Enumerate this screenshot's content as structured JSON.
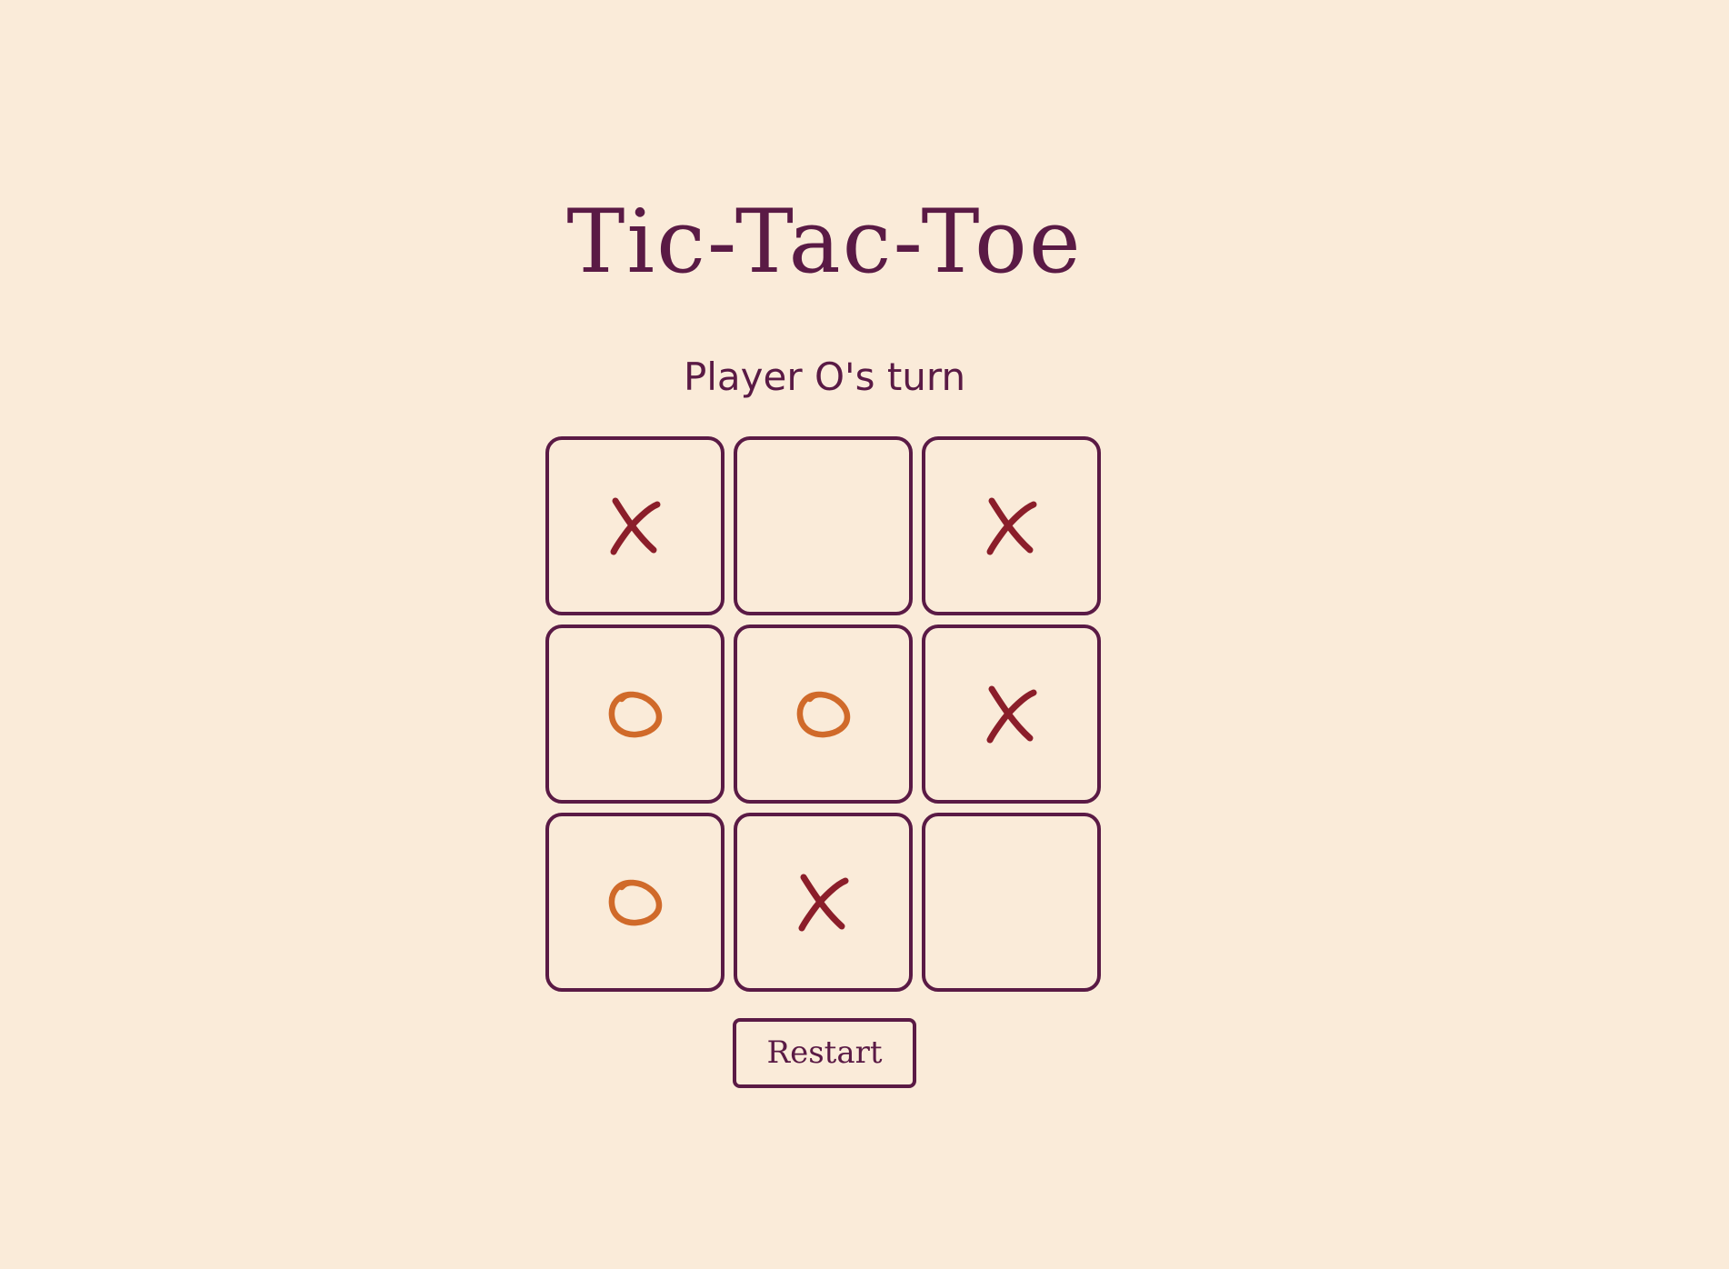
{
  "title": "Tic-Tac-Toe",
  "status": "Player O's turn",
  "board": {
    "cells": [
      "X",
      "",
      "X",
      "O",
      "O",
      "X",
      "O",
      "X",
      ""
    ]
  },
  "controls": {
    "restart_label": "Restart"
  },
  "colors": {
    "background": "#faebd9",
    "ink": "#5a1a45",
    "x_mark": "#8b1e2a",
    "o_mark": "#d06a2a"
  }
}
